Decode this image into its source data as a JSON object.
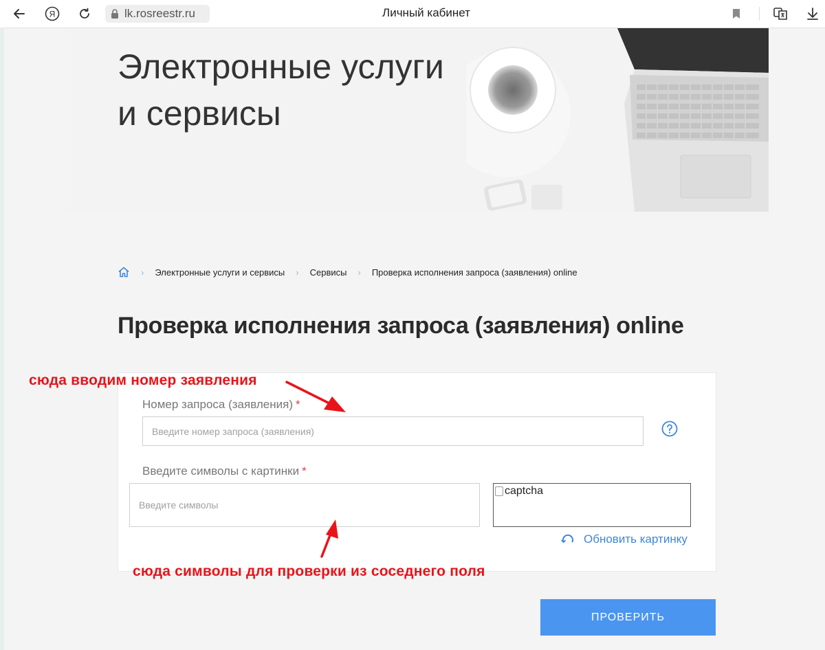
{
  "browser": {
    "url": "lk.rosreestr.ru",
    "tab_title": "Личный кабинет"
  },
  "hero": {
    "title": "Электронные услуги\nи сервисы"
  },
  "breadcrumb": {
    "items": [
      "Электронные услуги и сервисы",
      "Сервисы",
      "Проверка исполнения запроса (заявления) online"
    ]
  },
  "page": {
    "title": "Проверка исполнения запроса (заявления) online"
  },
  "form": {
    "request_label": "Номер запроса (заявления)",
    "required_mark": "*",
    "request_placeholder": "Введите номер запроса (заявления)",
    "captcha_label": "Введите символы с картинки",
    "captcha_placeholder": "Введите символы",
    "captcha_alt": "captcha",
    "refresh_label": "Обновить картинку",
    "submit_label": "ПРОВЕРИТЬ"
  },
  "annotations": {
    "top": "сюда вводим номер заявления",
    "bottom": "сюда символы для проверки из соседнего поля"
  },
  "colors": {
    "accent": "#4a95f0",
    "link": "#3f86d9",
    "annotation": "#e8141a",
    "required": "#e04040"
  }
}
